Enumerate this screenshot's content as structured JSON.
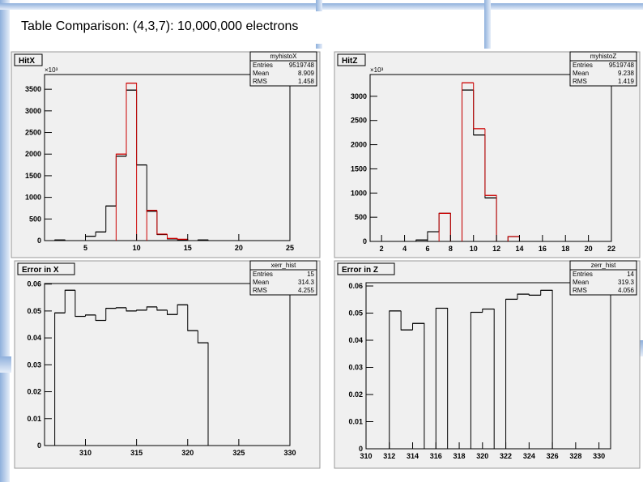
{
  "slide": {
    "title": "Table Comparison: (4,3,7): 10,000,000 electrons"
  },
  "chart_data": [
    {
      "type": "bar",
      "title": "HitX",
      "multiplier_label": "×10³",
      "stats": {
        "name": "myhistoX",
        "rows": [
          [
            "Entries",
            "9519748"
          ],
          [
            "Mean",
            "8.909"
          ],
          [
            "RMS",
            "1.458"
          ]
        ]
      },
      "xlim": [
        1,
        25
      ],
      "ylim": [
        0,
        3840
      ],
      "xticks": [
        5,
        10,
        15,
        20,
        25
      ],
      "yticks": [
        0,
        500,
        1000,
        1500,
        2000,
        2500,
        3000,
        3500
      ],
      "bin_width": 1,
      "series": [
        {
          "name": "black",
          "color": "#000000",
          "bins": [
            2,
            5,
            6,
            7,
            8,
            9,
            10,
            11,
            12,
            13,
            14,
            16
          ],
          "values": [
            15,
            100,
            200,
            800,
            1950,
            3480,
            1750,
            680,
            140,
            40,
            20,
            15
          ]
        },
        {
          "name": "red",
          "color": "#cc0000",
          "bins": [
            8,
            9,
            11,
            12,
            13,
            14
          ],
          "values": [
            2000,
            3640,
            700,
            150,
            50,
            30
          ]
        }
      ]
    },
    {
      "type": "bar",
      "title": "HitZ",
      "multiplier_label": "×10³",
      "stats": {
        "name": "myhistoZ",
        "rows": [
          [
            "Entries",
            "9519748"
          ],
          [
            "Mean",
            "9.238"
          ],
          [
            "RMS",
            "1.419"
          ]
        ]
      },
      "xlim": [
        1,
        22
      ],
      "ylim": [
        0,
        3450
      ],
      "xticks": [
        2,
        4,
        6,
        8,
        10,
        12,
        14,
        16,
        18,
        20,
        22
      ],
      "yticks": [
        0,
        500,
        1000,
        1500,
        2000,
        2500,
        3000
      ],
      "bin_width": 1,
      "series": [
        {
          "name": "black",
          "color": "#000000",
          "bins": [
            5,
            6,
            7,
            9,
            10,
            11,
            13
          ],
          "values": [
            30,
            200,
            580,
            3130,
            2200,
            900,
            100
          ]
        },
        {
          "name": "red",
          "color": "#cc0000",
          "bins": [
            7,
            9,
            10,
            11,
            13
          ],
          "values": [
            580,
            3280,
            2330,
            950,
            100
          ]
        }
      ]
    },
    {
      "type": "bar",
      "title": "Error in X",
      "multiplier_label": "",
      "stats": {
        "name": "xerr_hist",
        "rows": [
          [
            "Entries",
            "15"
          ],
          [
            "Mean",
            "314.3"
          ],
          [
            "RMS",
            "4.255"
          ]
        ]
      },
      "xlim": [
        306,
        330
      ],
      "ylim": [
        0,
        0.0602
      ],
      "xticks": [
        310,
        315,
        320,
        325,
        330
      ],
      "yticks": [
        0,
        0.01,
        0.02,
        0.03,
        0.04,
        0.05,
        0.06
      ],
      "bin_width": 1,
      "series": [
        {
          "name": "black",
          "color": "#000000",
          "bins": [
            307,
            308,
            309,
            310,
            311,
            312,
            313,
            314,
            315,
            316,
            317,
            318,
            319,
            320,
            321
          ],
          "values": [
            0.0493,
            0.0577,
            0.048,
            0.0485,
            0.0465,
            0.051,
            0.0512,
            0.05,
            0.0503,
            0.0515,
            0.0503,
            0.0487,
            0.0523,
            0.0427,
            0.0382
          ]
        }
      ]
    },
    {
      "type": "bar",
      "title": "Error in Z",
      "multiplier_label": "",
      "stats": {
        "name": "zerr_hist",
        "rows": [
          [
            "Entries",
            "14"
          ],
          [
            "Mean",
            "319.3"
          ],
          [
            "RMS",
            "4.056"
          ]
        ]
      },
      "xlim": [
        310,
        331
      ],
      "ylim": [
        0,
        0.0612
      ],
      "xticks": [
        310,
        312,
        314,
        316,
        318,
        320,
        322,
        324,
        326,
        328,
        330
      ],
      "yticks": [
        0,
        0.01,
        0.02,
        0.03,
        0.04,
        0.05,
        0.06
      ],
      "bin_width": 1,
      "series": [
        {
          "name": "black",
          "color": "#000000",
          "bins": [
            312,
            313,
            314,
            316,
            319,
            320,
            322,
            323,
            324,
            325
          ],
          "values": [
            0.0508,
            0.0438,
            0.0462,
            0.0518,
            0.0503,
            0.0515,
            0.0551,
            0.057,
            0.0566,
            0.0584
          ]
        }
      ]
    }
  ]
}
